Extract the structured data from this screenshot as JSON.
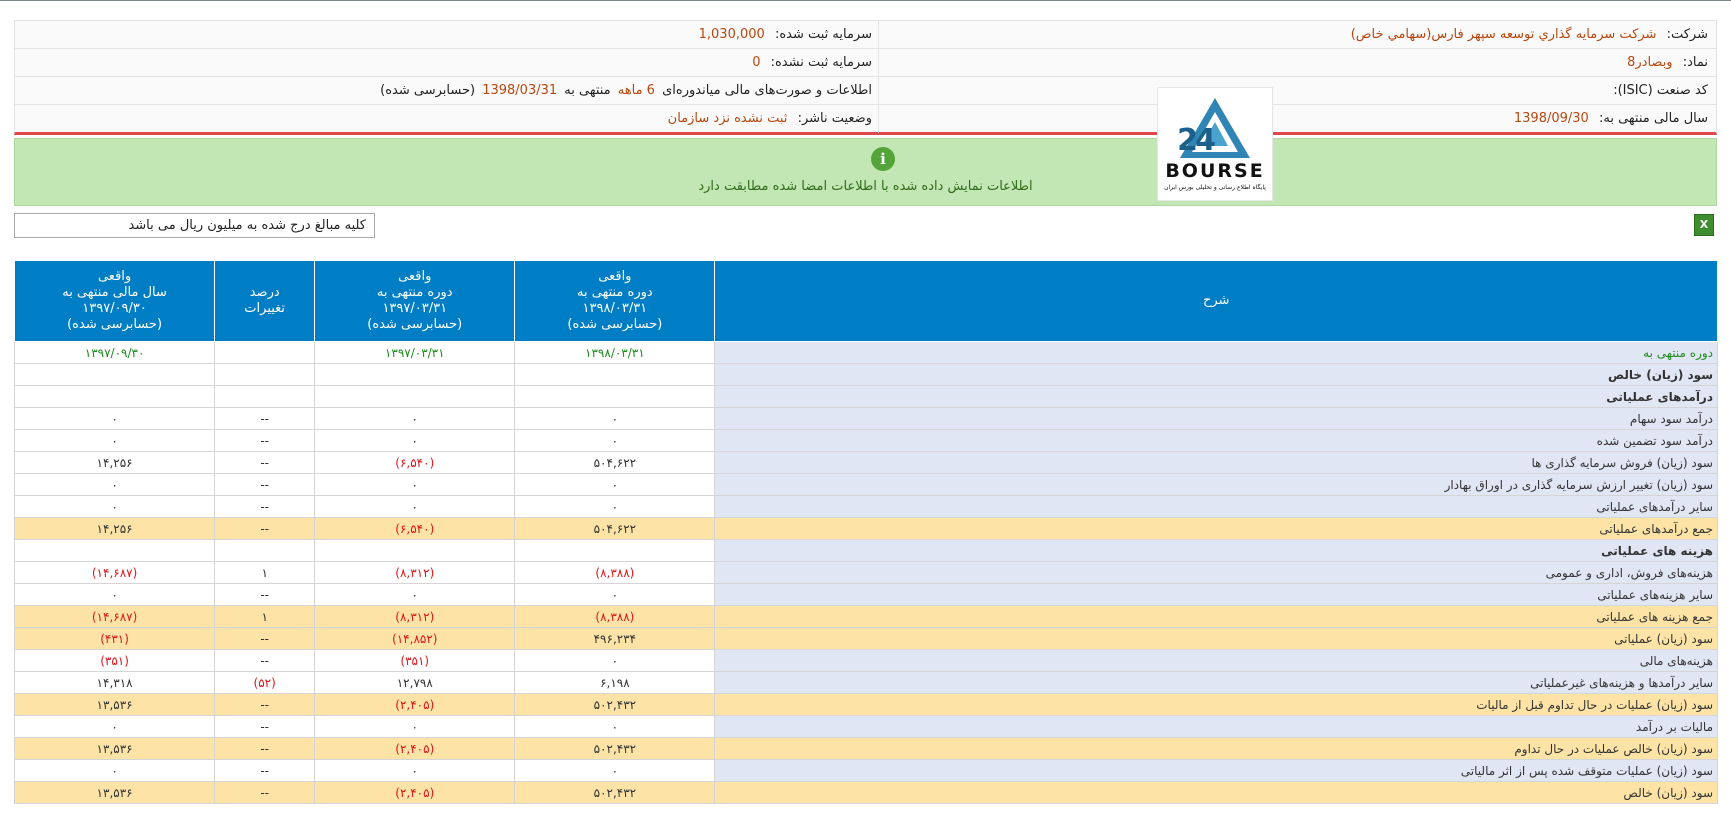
{
  "header": {
    "company_label": "شرکت:",
    "company_value": "شرکت سرمايه گذاري توسعه سپهر فارس(سهامي خاص)",
    "symbol_label": "نماد:",
    "symbol_value": "وبصادر8",
    "isic_label": "کد صنعت (ISIC):",
    "fiscal_label": "سال مالی منتهی به:",
    "fiscal_value": "1398/09/30",
    "reg_capital_label": "سرمایه ثبت شده:",
    "reg_capital_value": "1,030,000",
    "unreg_capital_label": "سرمایه ثبت نشده:",
    "unreg_capital_value": "0",
    "info_prefix": "اطلاعات و صورت‌های مالی میاندوره‌ای",
    "info_period": "6 ماهه",
    "info_middle": "منتهی به",
    "info_date": "1398/03/31",
    "info_suffix": "(حسابرسی شده)",
    "publisher_status_label": "وضعیت ناشر:",
    "publisher_status_value": "ثبت نشده نزد سازمان"
  },
  "logo": {
    "brand": "BOURSE",
    "subtitle": "پایگاه اطلاع رسانی و تحلیلی بورس ایران"
  },
  "notice": {
    "icon": "info-icon",
    "glyph": "i",
    "text": "اطلاعات نمایش داده شده با اطلاعات امضا شده مطابقت دارد"
  },
  "unit_note": "کلیه مبالغ درج شده به میلیون ریال می باشد",
  "excel": {
    "icon": "excel-export-icon",
    "glyph": "X"
  },
  "columns": {
    "desc": "شرح",
    "col1": [
      "واقعی",
      "دوره منتهی به",
      "۱۳۹۸/۰۳/۳۱",
      "(حسابرسی شده)"
    ],
    "col2": [
      "واقعی",
      "دوره منتهی به",
      "۱۳۹۷/۰۳/۳۱",
      "(حسابرسی شده)"
    ],
    "col3": [
      "درصد",
      "تغییرات"
    ],
    "col4": [
      "واقعی",
      "سال مالی منتهی به",
      "۱۳۹۷/۰۹/۳۰",
      "(حسابرسی شده)"
    ]
  },
  "rows": [
    {
      "desc": "دوره منتهی به",
      "c1": "۱۳۹۸/۰۳/۳۱",
      "c2": "۱۳۹۷/۰۳/۳۱",
      "c3": "",
      "c4": "۱۳۹۷/۰۹/۳۰",
      "type": "period"
    },
    {
      "desc": "سود (زیان) خالص",
      "c1": "",
      "c2": "",
      "c3": "",
      "c4": "",
      "type": "section"
    },
    {
      "desc": "درآمدهای عملیاتی",
      "c1": "",
      "c2": "",
      "c3": "",
      "c4": "",
      "type": "section"
    },
    {
      "desc": "درآمد سود سهام",
      "c1": "۰",
      "c2": "۰",
      "c3": "--",
      "c4": "۰",
      "type": "normal"
    },
    {
      "desc": "درآمد سود تضمین شده",
      "c1": "۰",
      "c2": "۰",
      "c3": "--",
      "c4": "۰",
      "type": "normal"
    },
    {
      "desc": "سود (زیان) فروش سرمایه گذاری ها",
      "c1": "۵۰۴,۶۲۲",
      "c2": "(۶,۵۴۰)",
      "c3": "--",
      "c4": "۱۴,۲۵۶",
      "type": "normal"
    },
    {
      "desc": "سود (زیان) تغییر ارزش سرمایه گذاری در اوراق بهادار",
      "c1": "۰",
      "c2": "۰",
      "c3": "--",
      "c4": "۰",
      "type": "normal"
    },
    {
      "desc": "سایر درآمدهای عملیاتی",
      "c1": "۰",
      "c2": "۰",
      "c3": "--",
      "c4": "۰",
      "type": "normal"
    },
    {
      "desc": "جمع درآمدهای عملیاتی",
      "c1": "۵۰۴,۶۲۲",
      "c2": "(۶,۵۴۰)",
      "c3": "--",
      "c4": "۱۴,۲۵۶",
      "type": "total"
    },
    {
      "desc": "هزینه های عملیاتی",
      "c1": "",
      "c2": "",
      "c3": "",
      "c4": "",
      "type": "section"
    },
    {
      "desc": "هزینه‌های فروش، اداری و عمومی",
      "c1": "(۸,۳۸۸)",
      "c2": "(۸,۳۱۲)",
      "c3": "۱",
      "c4": "(۱۴,۶۸۷)",
      "type": "normal"
    },
    {
      "desc": "سایر هزینه‌های عملیاتی",
      "c1": "۰",
      "c2": "۰",
      "c3": "--",
      "c4": "۰",
      "type": "normal"
    },
    {
      "desc": "جمع هزینه های عملیاتی",
      "c1": "(۸,۳۸۸)",
      "c2": "(۸,۳۱۲)",
      "c3": "۱",
      "c4": "(۱۴,۶۸۷)",
      "type": "total"
    },
    {
      "desc": "سود (زیان) عملیاتی",
      "c1": "۴۹۶,۲۳۴",
      "c2": "(۱۴,۸۵۲)",
      "c3": "--",
      "c4": "(۴۳۱)",
      "type": "total"
    },
    {
      "desc": "هزینه‌های مالی",
      "c1": "۰",
      "c2": "(۳۵۱)",
      "c3": "--",
      "c4": "(۳۵۱)",
      "type": "normal"
    },
    {
      "desc": "سایر درآمدها و هزینه‌های غیرعملیاتی",
      "c1": "۶,۱۹۸",
      "c2": "۱۲,۷۹۸",
      "c3": "(۵۲)",
      "c4": "۱۴,۳۱۸",
      "type": "normal"
    },
    {
      "desc": "سود (زیان) عملیات در حال تداوم قبل از مالیات",
      "c1": "۵۰۲,۴۳۲",
      "c2": "(۲,۴۰۵)",
      "c3": "--",
      "c4": "۱۳,۵۳۶",
      "type": "total"
    },
    {
      "desc": "مالیات بر درآمد",
      "c1": "۰",
      "c2": "۰",
      "c3": "--",
      "c4": "۰",
      "type": "normal"
    },
    {
      "desc": "سود (زیان) خالص عملیات در حال تداوم",
      "c1": "۵۰۲,۴۳۲",
      "c2": "(۲,۴۰۵)",
      "c3": "--",
      "c4": "۱۳,۵۳۶",
      "type": "total"
    },
    {
      "desc": "سود (زیان) عملیات متوقف شده پس از اثر مالیاتی",
      "c1": "۰",
      "c2": "۰",
      "c3": "--",
      "c4": "۰",
      "type": "normal"
    },
    {
      "desc": "سود (زیان) خالص",
      "c1": "۵۰۲,۴۳۲",
      "c2": "(۲,۴۰۵)",
      "c3": "--",
      "c4": "۱۳,۵۳۶",
      "type": "total"
    }
  ]
}
